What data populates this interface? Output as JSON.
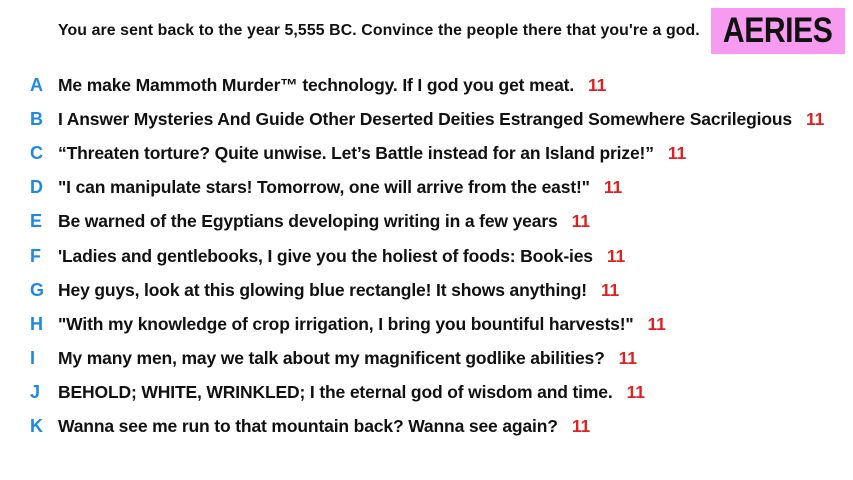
{
  "prompt": "You are sent back to the year 5,555 BC. Convince the people there that you're a god.",
  "team": "AERIES",
  "colors": {
    "badge": "#f79bf0",
    "letter": "#1e88e5",
    "score": "#e02020"
  },
  "answers": [
    {
      "letter": "A",
      "text": "Me make Mammoth Murder™ technology. If I god you get meat.",
      "score": "11"
    },
    {
      "letter": "B",
      "text": "I Answer Mysteries And Guide Other Deserted Deities Estranged Somewhere Sacrilegious",
      "score": "11"
    },
    {
      "letter": "C",
      "text": "“Threaten torture? Quite unwise. Let’s Battle instead for an Island prize!”",
      "score": "11"
    },
    {
      "letter": "D",
      "text": "\"I can manipulate stars! Tomorrow, one will arrive from the east!\"",
      "score": "11"
    },
    {
      "letter": "E",
      "text": "Be warned of the Egyptians developing writing in a few years",
      "score": "11"
    },
    {
      "letter": "F",
      "text": "'Ladies and gentlebooks, I give you the holiest of foods: Book-ies",
      "score": "11"
    },
    {
      "letter": "G",
      "text": "Hey guys, look at this glowing blue rectangle! It shows anything!",
      "score": "11"
    },
    {
      "letter": "H",
      "text": "\"With my knowledge of crop irrigation, I bring you bountiful harvests!\"",
      "score": "11"
    },
    {
      "letter": "I",
      "text": "My many men, may we talk about my magnificent godlike abilities?",
      "score": "11"
    },
    {
      "letter": "J",
      "text": "BEHOLD; WHITE, WRINKLED; I the eternal god of wisdom and time.",
      "score": "11"
    },
    {
      "letter": "K",
      "text": "Wanna see me run to that mountain back? Wanna see again?",
      "score": "11"
    }
  ]
}
